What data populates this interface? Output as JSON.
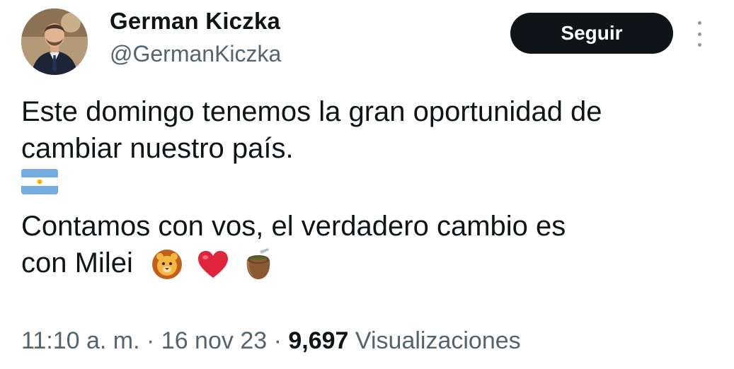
{
  "author": {
    "display_name": "German Kiczka",
    "handle": "@GermanKiczka",
    "avatar_icon": "profile-photo"
  },
  "follow_button": {
    "label": "Seguir"
  },
  "more_options_icon": "vertical-ellipsis-icon",
  "tweet": {
    "line1": "Este domingo tenemos la gran oportunidad de",
    "line2": "cambiar nuestro país.",
    "flag_emoji": "🇦🇷",
    "line3": "Contamos con vos, el verdadero cambio es",
    "line4": "con Milei",
    "trailing_emojis": [
      "🦁",
      "❤️",
      "🧉"
    ]
  },
  "meta": {
    "time": "11:10 a. m.",
    "sep1": " · ",
    "date": "16 nov 23",
    "sep2": " · ",
    "views_count": "9,697",
    "views_label": "Visualizaciones"
  },
  "colors": {
    "text_primary": "#0f1419",
    "text_secondary": "#536471",
    "button_bg": "#0f1419",
    "button_text": "#ffffff",
    "heart_red": "#e0243b",
    "flag_blue": "#74acdf",
    "sun_yellow": "#f6b40e"
  }
}
